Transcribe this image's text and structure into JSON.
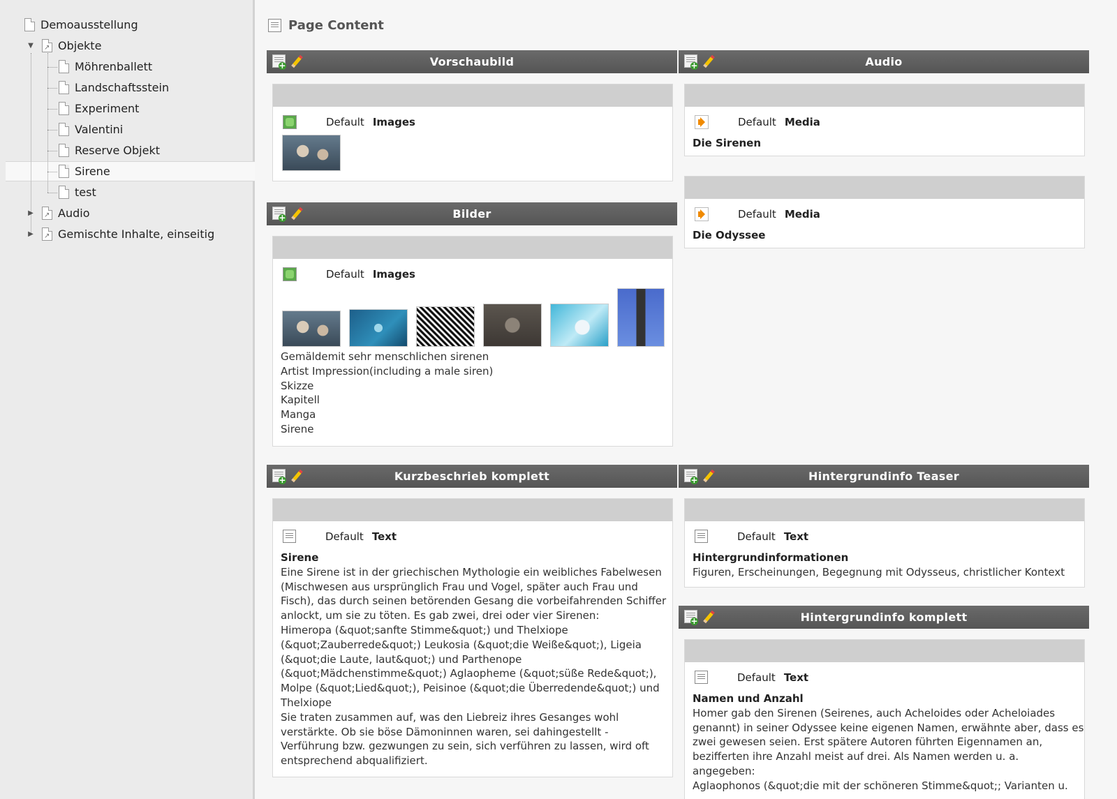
{
  "tree": {
    "root": "Demoausstellung",
    "objekte": "Objekte",
    "children": [
      "Möhrenballett",
      "Landschaftsstein",
      "Experiment",
      "Valentini",
      "Reserve Objekt",
      "Sirene",
      "test"
    ],
    "audio": "Audio",
    "gemischt": "Gemischte Inhalte, einseitig",
    "selected": "Sirene"
  },
  "page": {
    "title": "Page Content"
  },
  "columns": {
    "vorschaubild": "Vorschaubild",
    "audio": "Audio",
    "bilder": "Bilder",
    "kurzbeschrieb": "Kurzbeschrieb komplett",
    "teaser": "Hintergrundinfo Teaser",
    "komplett": "Hintergrundinfo komplett"
  },
  "elements": {
    "vorschau": {
      "layout": "Default",
      "type": "Images"
    },
    "audio1": {
      "layout": "Default",
      "type": "Media",
      "title": "Die Sirenen"
    },
    "audio2": {
      "layout": "Default",
      "type": "Media",
      "title": "Die Odyssee"
    },
    "bilder": {
      "layout": "Default",
      "type": "Images",
      "captions": [
        "Gemäldemit sehr menschlichen sirenen",
        "Artist Impression(including a male siren)",
        "Skizze",
        "Kapitell",
        "Manga",
        "Sirene"
      ]
    },
    "kurz": {
      "layout": "Default",
      "type": "Text",
      "heading": "Sirene",
      "lines": [
        "Eine Sirene ist in der griechischen Mythologie ein weibliches Fabelwesen",
        "(Mischwesen aus ursprünglich Frau und Vogel, später auch Frau und",
        "Fisch), das durch seinen betörenden Gesang die vorbeifahrenden Schiffer",
        "anlockt, um sie zu töten. Es gab zwei, drei oder vier Sirenen:",
        "Himeropa (&quot;sanfte Stimme&quot;) und Thelxiope",
        "(&quot;Zauberrede&quot;) Leukosia (&quot;die Weiße&quot;), Ligeia",
        "(&quot;die Laute, laut&quot;) und Parthenope",
        "(&quot;Mädchenstimme&quot;) Aglaopheme (&quot;süße Rede&quot;),",
        "Molpe (&quot;Lied&quot;), Peisinoe (&quot;die Überredende&quot;) und",
        "Thelxiope",
        "Sie traten zusammen auf, was den Liebreiz ihres Gesanges wohl",
        "verstärkte. Ob sie böse Dämoninnen waren, sei dahingestellt -",
        "Verführung bzw. gezwungen zu sein, sich verführen zu lassen, wird oft",
        "entsprechend abqualifiziert."
      ]
    },
    "teaser": {
      "layout": "Default",
      "type": "Text",
      "heading": "Hintergrundinformationen",
      "lines": [
        "Figuren, Erscheinungen, Begegnung mit Odysseus, christlicher Kontext"
      ]
    },
    "komplett": {
      "layout": "Default",
      "type": "Text",
      "heading": "Namen und Anzahl",
      "lines": [
        "Homer gab den Sirenen (Seirenes, auch Acheloides oder Acheloiades",
        "genannt) in seiner Odyssee keine eigenen Namen, erwähnte aber, dass es",
        "zwei gewesen seien. Erst spätere Autoren führten Eigennamen an,",
        "bezifferten ihre Anzahl meist auf drei. Als Namen werden u. a.",
        "angegeben:",
        "Aglaophonos (&quot;die mit der schöneren Stimme&quot;; Varianten u."
      ]
    }
  }
}
